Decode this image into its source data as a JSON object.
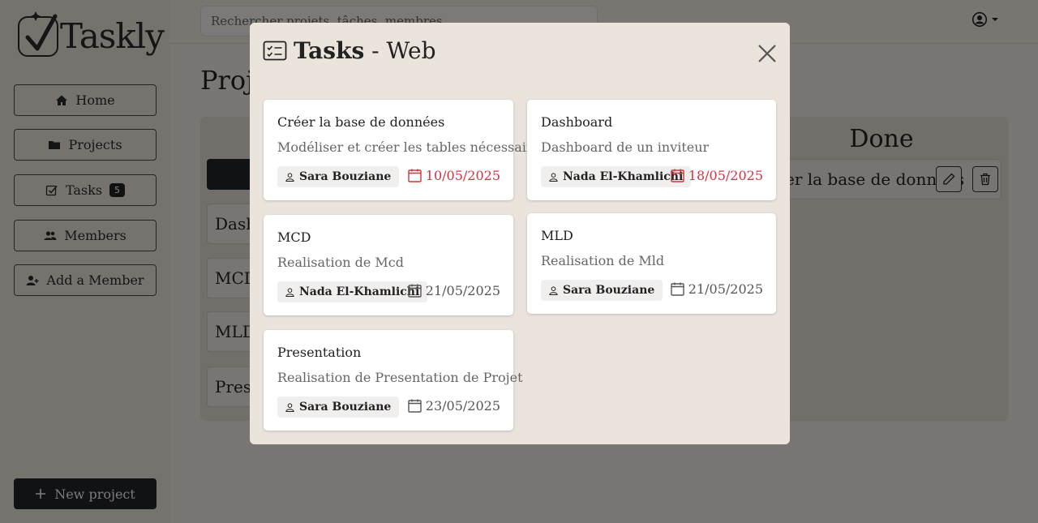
{
  "app": {
    "name": "Taskly"
  },
  "search": {
    "placeholder": "Rechercher projets, tâches, membres..."
  },
  "sidebar": {
    "items": [
      {
        "label": "Home",
        "icon": "home-icon"
      },
      {
        "label": "Projects",
        "icon": "folder-icon"
      },
      {
        "label": "Tasks",
        "icon": "check-square-icon",
        "badge": "5"
      },
      {
        "label": "Members",
        "icon": "users-icon"
      },
      {
        "label": "Add a Member",
        "icon": "user-plus-icon"
      }
    ],
    "new_project_label": "New project"
  },
  "main": {
    "page_title_partial": "Proje",
    "board": {
      "cards_partial": [
        "Dash",
        "MCD",
        "MLD",
        "Prese"
      ],
      "done_column": {
        "title": "Done",
        "card_text_partial": "er la base de données"
      }
    }
  },
  "modal": {
    "title_bold": "Tasks",
    "title_rest": " - Web",
    "tasks": [
      {
        "title": "Créer la base de données",
        "description": "Modéliser et créer les tables nécessaires.",
        "assignee": "Sara Bouziane",
        "due_date": "10/05/2025",
        "overdue": true
      },
      {
        "title": "Dashboard",
        "description": "Dashboard de un inviteur",
        "assignee": "Nada El-Khamlichi",
        "due_date": "18/05/2025",
        "overdue": true
      },
      {
        "title": "MCD",
        "description": "Realisation de Mcd",
        "assignee": "Nada El-Khamlichi",
        "due_date": "21/05/2025",
        "overdue": false
      },
      {
        "title": "MLD",
        "description": "Realisation de Mld",
        "assignee": "Sara Bouziane",
        "due_date": "21/05/2025",
        "overdue": false
      },
      {
        "title": "Presentation",
        "description": "Realisation de Presentation de Projet",
        "assignee": "Sara Bouziane",
        "due_date": "23/05/2025",
        "overdue": false
      }
    ]
  },
  "colors": {
    "overdue": "#d0343e",
    "dark_button": "#212529",
    "modal_bg": "#ebe4dd"
  }
}
